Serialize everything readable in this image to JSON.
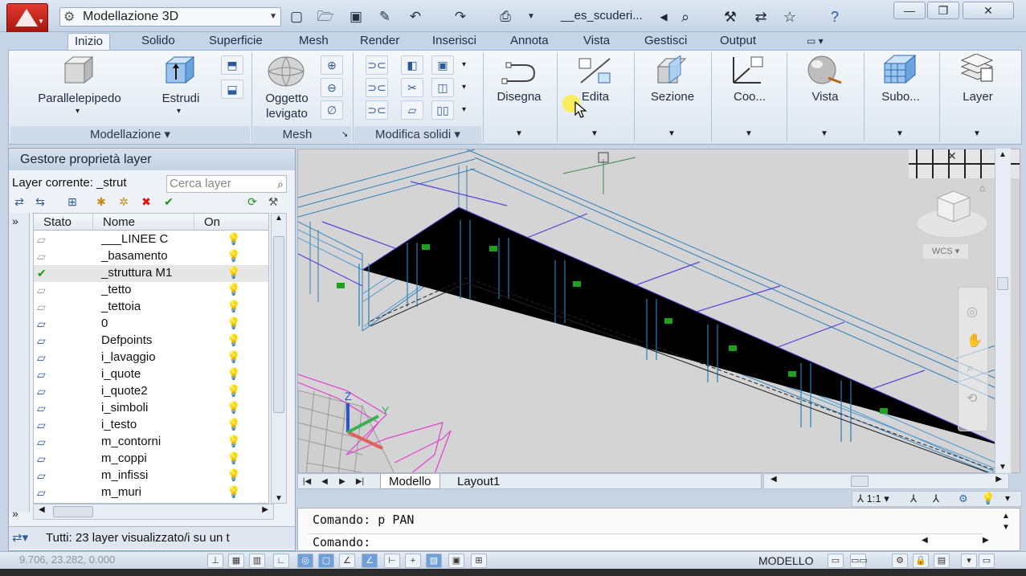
{
  "titlebar": {
    "workspace": "Modellazione 3D",
    "doc_title": "__es_scuderi...",
    "quick_access": [
      "new-icon",
      "open-icon",
      "save-icon",
      "saveas-icon",
      "undo-icon",
      "redo-icon",
      "plot-icon"
    ],
    "tools": [
      "binoculars-icon",
      "wrench-icon",
      "exchange-icon",
      "star-icon",
      "help-icon"
    ]
  },
  "tabs": [
    "Inizio",
    "Solido",
    "Superficie",
    "Mesh",
    "Render",
    "Inserisci",
    "Annota",
    "Vista",
    "Gestisci",
    "Output"
  ],
  "ribbon": {
    "modellazione": {
      "label": "Modellazione",
      "parallelepipedo": "Parallelepipedo",
      "estrudi": "Estrudi"
    },
    "mesh": {
      "label": "Mesh",
      "oggetto": "Oggetto",
      "levigato": "levigato"
    },
    "modifica": {
      "label": "Modifica solidi"
    },
    "disegna": "Disegna",
    "edita": "Edita",
    "sezione": "Sezione",
    "coo": "Coo...",
    "vista": "Vista",
    "subo": "Subo...",
    "layer": "Layer"
  },
  "palette": {
    "title": "Gestore proprietà layer",
    "current_layer": "Layer  corrente: _strut",
    "search_placeholder": "Cerca layer",
    "columns": {
      "stato": "Stato",
      "nome": "Nome",
      "on": "On"
    },
    "layers": [
      {
        "name": "___LINEE C",
        "current": false
      },
      {
        "name": "_basamento",
        "current": false
      },
      {
        "name": "_struttura M1",
        "current": true
      },
      {
        "name": "_tetto",
        "current": false
      },
      {
        "name": "_tettoia",
        "current": false
      },
      {
        "name": "0",
        "current": false
      },
      {
        "name": "Defpoints",
        "current": false
      },
      {
        "name": "i_lavaggio",
        "current": false
      },
      {
        "name": "i_quote",
        "current": false
      },
      {
        "name": "i_quote2",
        "current": false
      },
      {
        "name": "i_simboli",
        "current": false
      },
      {
        "name": "i_testo",
        "current": false
      },
      {
        "name": "m_contorni",
        "current": false
      },
      {
        "name": "m_coppi",
        "current": false
      },
      {
        "name": "m_infissi",
        "current": false
      },
      {
        "name": "m_muri",
        "current": false
      }
    ],
    "status": "Tutti: 23 layer visualizzato/i su un t"
  },
  "viewport": {
    "wcs": "WCS",
    "axis_z": "Z",
    "axis_y": "Y"
  },
  "layout_tabs": [
    "Modello",
    "Layout1"
  ],
  "annotation_scale": "1:1",
  "command": {
    "history": "Comando:  p PAN",
    "prompt": "Comando:"
  },
  "status": {
    "coords": "9.706,  23.282, 0.000",
    "space": "MODELLO"
  },
  "colors": {
    "accent": "#2f6fb5",
    "structure": "#2c7fb8",
    "beams": "#5a3fd6",
    "ribbon": "#dde6f0"
  }
}
